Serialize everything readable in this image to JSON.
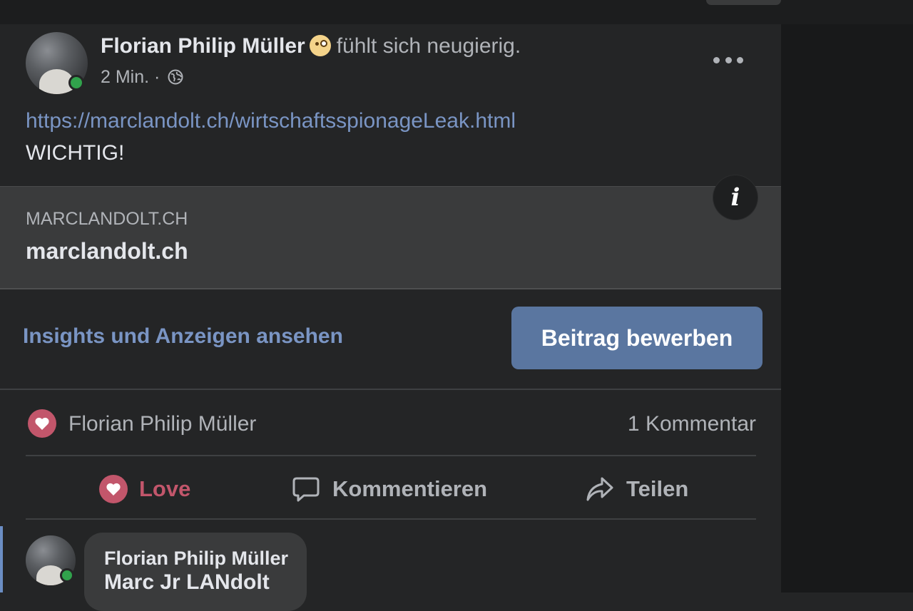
{
  "post": {
    "author": "Florian Philip Müller",
    "feeling": "fühlt sich neugierig.",
    "time": "2 Min. ·",
    "audience_icon": "globe-icon",
    "link": "https://marclandolt.ch/wirtschaftsspionageLeak.html",
    "text": "WICHTIG!",
    "more_icon": "more-options-icon"
  },
  "preview": {
    "domain": "MARCLANDOLT.CH",
    "title": "marclandolt.ch",
    "info_icon": "info-icon"
  },
  "promo": {
    "insights_label": "Insights und Anzeigen ansehen",
    "promote_label": "Beitrag bewerben"
  },
  "reactions": {
    "reactor": "Florian Philip Müller",
    "comment_count": "1 Kommentar"
  },
  "actions": {
    "love": "Love",
    "comment": "Kommentieren",
    "share": "Teilen"
  },
  "comment": {
    "author": "Florian Philip Müller",
    "text": "Marc Jr LANdolt"
  },
  "colors": {
    "background": "#242526",
    "link": "#7a95c4",
    "love": "#c2566b",
    "promote_button": "#5a76a0",
    "online": "#31a24c"
  }
}
